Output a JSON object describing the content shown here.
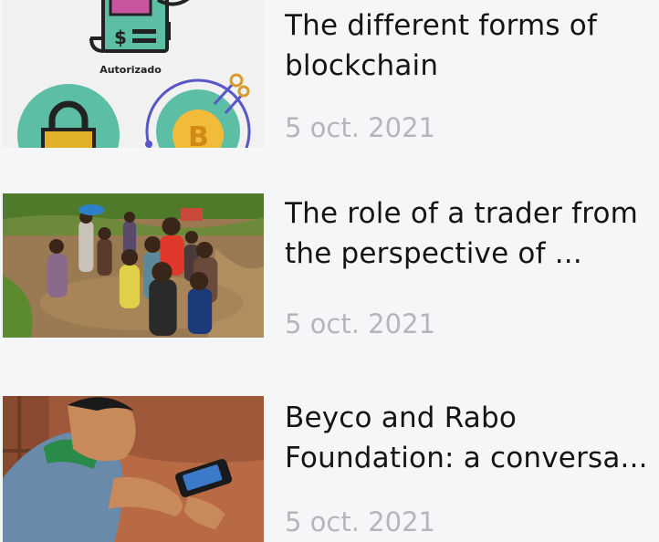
{
  "articles": [
    {
      "title_line1": "The different forms of",
      "title_line2": "blockchain",
      "date": "5 oct. 2021",
      "thumb_caption": "Autorizado",
      "thumb_icons": [
        "receipt-icon",
        "padlock-icon",
        "bitcoin-icon"
      ]
    },
    {
      "title_line1": "The role of a trader from",
      "title_line2": "the perspective of ...",
      "date": "5 oct. 2021"
    },
    {
      "title_line1": "Beyco and Rabo",
      "title_line2": "Foundation: a conversa...",
      "date": "5 oct. 2021"
    }
  ],
  "colors": {
    "background": "#f5f6f8",
    "title": "#151515",
    "date": "#b4b6ba"
  }
}
